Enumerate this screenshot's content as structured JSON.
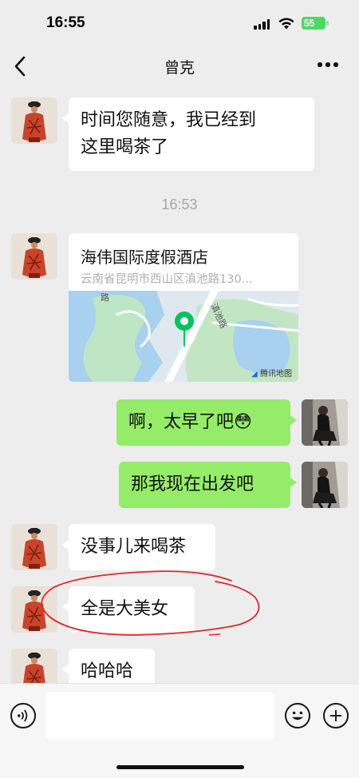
{
  "status_bar": {
    "time": "16:55",
    "battery": "55"
  },
  "nav": {
    "title": "曾克"
  },
  "messages": [
    {
      "side": "left",
      "text_line1": "时间您随意，我已经到",
      "text_line2": "这里喝茶了"
    },
    {
      "type": "timestamp",
      "text": "16:53"
    },
    {
      "side": "left",
      "type": "location",
      "title": "海伟国际度假酒店",
      "address": "云南省昆明市西山区滇池路130...",
      "map_brand": "腾讯地图"
    },
    {
      "side": "right",
      "text": "啊，太早了吧",
      "emoji": "😳"
    },
    {
      "side": "right",
      "text": "那我现在出发吧"
    },
    {
      "side": "left",
      "text": "没事儿来喝茶"
    },
    {
      "side": "left",
      "text": "全是大美女",
      "annotation": "red-circle"
    },
    {
      "side": "left",
      "text": "哈哈哈"
    }
  ],
  "map_labels": {
    "road_top": "滇池路",
    "road_left": "路"
  },
  "colors": {
    "background": "#ededed",
    "bubble_self": "#95ec69",
    "bubble_other": "#ffffff",
    "location_pin": "#07c160",
    "annotation": "#e0282b"
  },
  "icons": {
    "back": "chevron-left-icon",
    "more": "more-icon",
    "voice": "voice-icon",
    "emoji": "emoji-icon",
    "plus": "plus-icon"
  }
}
